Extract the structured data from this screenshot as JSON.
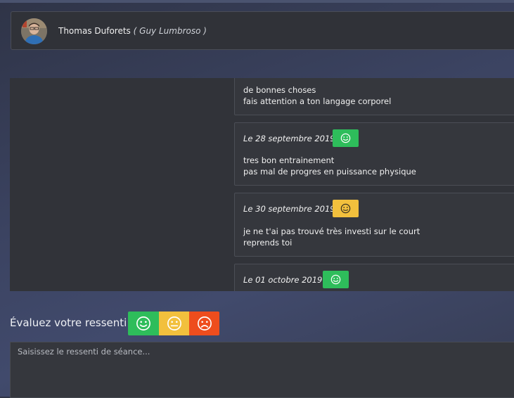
{
  "header": {
    "athlete_name": "Thomas Duforets",
    "open_paren": "(",
    "coach_name": "Guy Lumbroso",
    "close_paren": ")"
  },
  "feed": [
    {
      "date": "",
      "mood": "",
      "lines": [
        "de bonnes choses",
        "fais attention a ton langage corporel"
      ]
    },
    {
      "date": "Le 28 septembre 2019",
      "mood": "happy",
      "lines": [
        "tres bon entrainement",
        "pas mal de progres en puissance physique"
      ]
    },
    {
      "date": "Le 30 septembre 2019",
      "mood": "neutral",
      "lines": [
        "je ne t'ai pas trouvé très investi sur le court",
        "reprends toi"
      ]
    },
    {
      "date": "Le 01 octobre 2019",
      "mood": "happy",
      "lines": []
    }
  ],
  "rating": {
    "label": "Évaluez votre ressenti :",
    "options": [
      {
        "mood": "happy",
        "icon": "smile-icon",
        "color": "#2ebd5b"
      },
      {
        "mood": "neutral",
        "icon": "neutral-face-icon",
        "color": "#f2c03d"
      },
      {
        "mood": "sad",
        "icon": "frown-icon",
        "color": "#ee4d1d"
      }
    ]
  },
  "note": {
    "placeholder": "Saisissez le ressenti de séance..."
  },
  "colors": {
    "happy": "#2ebd5b",
    "neutral": "#f2c03d",
    "sad": "#ee4d1d"
  }
}
